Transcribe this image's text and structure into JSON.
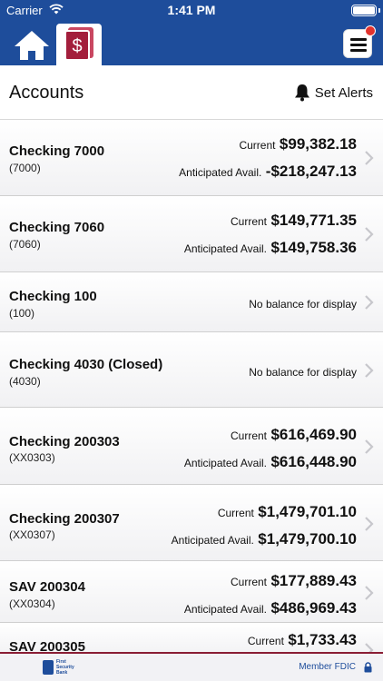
{
  "status_bar": {
    "carrier": "Carrier",
    "time": "1:41 PM"
  },
  "nav": {
    "accounts_icon_glyph": "$"
  },
  "header": {
    "title": "Accounts",
    "alerts_label": "Set Alerts"
  },
  "accounts": [
    {
      "name": "Checking 7000",
      "number": "(7000)",
      "current_label": "Current",
      "current": "$99,382.18",
      "avail_label": "Anticipated Avail.",
      "avail": "-$218,247.13"
    },
    {
      "name": "Checking 7060",
      "number": "(7060)",
      "current_label": "Current",
      "current": "$149,771.35",
      "avail_label": "Anticipated Avail.",
      "avail": "$149,758.36"
    },
    {
      "name": "Checking 100",
      "number": "(100)",
      "message": "No balance for display"
    },
    {
      "name": "Checking 4030 (Closed)",
      "number": "(4030)",
      "message": "No balance for display"
    },
    {
      "name": "Checking 200303",
      "number": "(XX0303)",
      "current_label": "Current",
      "current": "$616,469.90",
      "avail_label": "Anticipated Avail.",
      "avail": "$616,448.90"
    },
    {
      "name": "Checking 200307",
      "number": "(XX0307)",
      "current_label": "Current",
      "current": "$1,479,701.10",
      "avail_label": "Anticipated Avail.",
      "avail": "$1,479,700.10"
    },
    {
      "name": "SAV 200304",
      "number": "(XX0304)",
      "current_label": "Current",
      "current": "$177,889.43",
      "avail_label": "Anticipated Avail.",
      "avail": "$486,969.43"
    },
    {
      "name": "SAV 200305",
      "current_label": "Current",
      "current": "$1,733.43"
    }
  ],
  "footer": {
    "logo_line1": "First",
    "logo_line2": "Security",
    "logo_line3": "Bank",
    "fdic": "Member FDIC"
  },
  "colors": {
    "brand_blue": "#1e4d9b",
    "brand_red": "#a31f3c",
    "badge_red": "#e2332d"
  }
}
